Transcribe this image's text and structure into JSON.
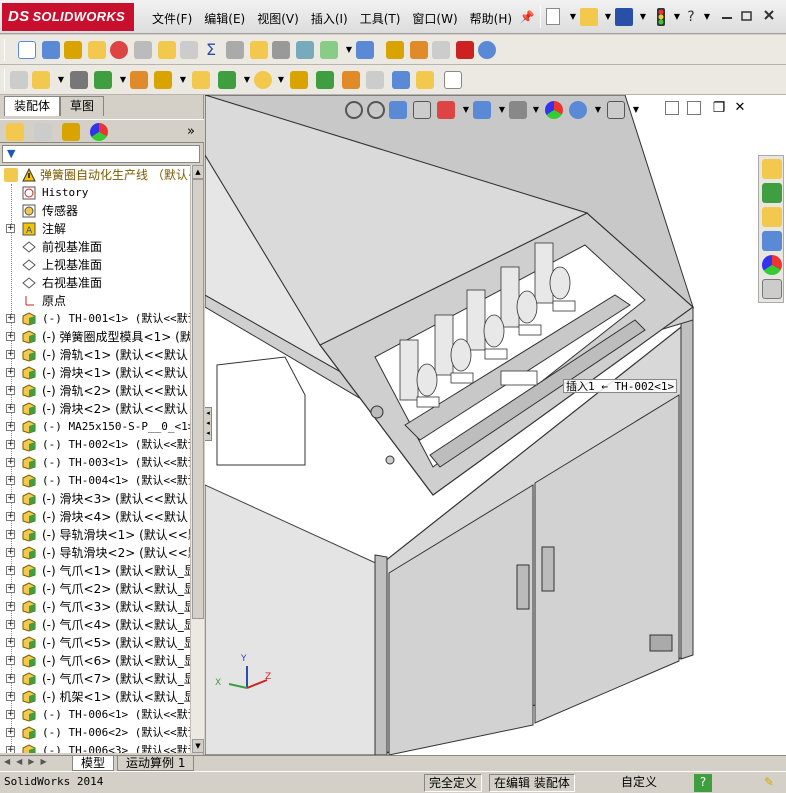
{
  "app": {
    "brand": "SOLIDWORKS",
    "brand_prefix": "DS"
  },
  "menu": [
    "文件(F)",
    "编辑(E)",
    "视图(V)",
    "插入(I)",
    "工具(T)",
    "窗口(W)",
    "帮助(H)"
  ],
  "panel": {
    "tabs": [
      "装配体",
      "草图"
    ],
    "active_tab": "装配体",
    "filter_glyph": "▼",
    "collapse_glyph": "»"
  },
  "tree": {
    "root": "弹簧圈自动化生产线 （默认<",
    "items": [
      {
        "label": "History",
        "icon": "history-icon",
        "mono": true,
        "expandable": false
      },
      {
        "label": "传感器",
        "icon": "sensor-icon",
        "mono": false,
        "expandable": false
      },
      {
        "label": "注解",
        "icon": "annotation-icon",
        "mono": false,
        "expandable": true
      },
      {
        "label": "前视基准面",
        "icon": "plane-icon",
        "mono": false,
        "expandable": false
      },
      {
        "label": "上视基准面",
        "icon": "plane-icon",
        "mono": false,
        "expandable": false
      },
      {
        "label": "右视基准面",
        "icon": "plane-icon",
        "mono": false,
        "expandable": false
      },
      {
        "label": "原点",
        "icon": "origin-icon",
        "mono": false,
        "expandable": false
      },
      {
        "label": "(-) TH-001<1> (默认<<默认",
        "icon": "part-icon",
        "mono": true,
        "expandable": true
      },
      {
        "label": "(-) 弹簧圈成型模具<1> (默",
        "icon": "part-icon",
        "mono": false,
        "expandable": true
      },
      {
        "label": "(-) 滑轨<1> (默认<<默认",
        "icon": "part-icon",
        "mono": false,
        "expandable": true
      },
      {
        "label": "(-) 滑块<1> (默认<<默认",
        "icon": "part-icon",
        "mono": false,
        "expandable": true
      },
      {
        "label": "(-) 滑轨<2> (默认<<默认",
        "icon": "part-icon",
        "mono": false,
        "expandable": true
      },
      {
        "label": "(-) 滑块<2> (默认<<默认",
        "icon": "part-icon",
        "mono": false,
        "expandable": true
      },
      {
        "label": "(-) MA25x150-S-P__0_<1>",
        "icon": "part-icon",
        "mono": true,
        "expandable": true
      },
      {
        "label": "(-) TH-002<1> (默认<<默认",
        "icon": "part-icon",
        "mono": true,
        "expandable": true
      },
      {
        "label": "(-) TH-003<1> (默认<<默认",
        "icon": "part-icon",
        "mono": true,
        "expandable": true
      },
      {
        "label": "(-) TH-004<1> (默认<<默认",
        "icon": "part-icon",
        "mono": true,
        "expandable": true
      },
      {
        "label": "(-) 滑块<3> (默认<<默认",
        "icon": "part-icon",
        "mono": false,
        "expandable": true
      },
      {
        "label": "(-) 滑块<4> (默认<<默认",
        "icon": "part-icon",
        "mono": false,
        "expandable": true
      },
      {
        "label": "(-) 导轨滑块<1> (默认<<默",
        "icon": "part-icon",
        "mono": false,
        "expandable": true
      },
      {
        "label": "(-) 导轨滑块<2> (默认<<默",
        "icon": "part-icon",
        "mono": false,
        "expandable": true
      },
      {
        "label": "(-) 气爪<1> (默认<默认_显",
        "icon": "part-icon",
        "mono": false,
        "expandable": true
      },
      {
        "label": "(-) 气爪<2> (默认<默认_显",
        "icon": "part-icon",
        "mono": false,
        "expandable": true
      },
      {
        "label": "(-) 气爪<3> (默认<默认_显",
        "icon": "part-icon",
        "mono": false,
        "expandable": true
      },
      {
        "label": "(-) 气爪<4> (默认<默认_显",
        "icon": "part-icon",
        "mono": false,
        "expandable": true
      },
      {
        "label": "(-) 气爪<5> (默认<默认_显",
        "icon": "part-icon",
        "mono": false,
        "expandable": true
      },
      {
        "label": "(-) 气爪<6> (默认<默认_显",
        "icon": "part-icon",
        "mono": false,
        "expandable": true
      },
      {
        "label": "(-) 气爪<7> (默认<默认_显",
        "icon": "part-icon",
        "mono": false,
        "expandable": true
      },
      {
        "label": "(-) 机架<1> (默认<默认_显",
        "icon": "part-icon",
        "mono": false,
        "expandable": true
      },
      {
        "label": "(-) TH-006<1> (默认<<默认",
        "icon": "part-icon",
        "mono": true,
        "expandable": true
      },
      {
        "label": "(-) TH-006<2> (默认<<默认",
        "icon": "part-icon",
        "mono": true,
        "expandable": true
      },
      {
        "label": "(-) TH-006<3> (默认<<默认",
        "icon": "part-icon",
        "mono": true,
        "expandable": true
      }
    ]
  },
  "viewport": {
    "callout": "插入1 ← TH-002<1>",
    "triad": {
      "x": "X",
      "y": "Y",
      "z": "Z"
    }
  },
  "bottom_tabs": [
    "模型",
    "运动算例 1"
  ],
  "status": {
    "app_version": "SolidWorks 2014",
    "constraint": "完全定义",
    "editing": "在编辑 装配体",
    "units": "自定义",
    "help": "?"
  },
  "colors": {
    "brand_red": "#c8102e",
    "machine_gray": "#d2d2d2",
    "highlight_yellow": "#f5c400",
    "part_yellow": "#f2c94c",
    "part_green": "#3f9e3f"
  }
}
